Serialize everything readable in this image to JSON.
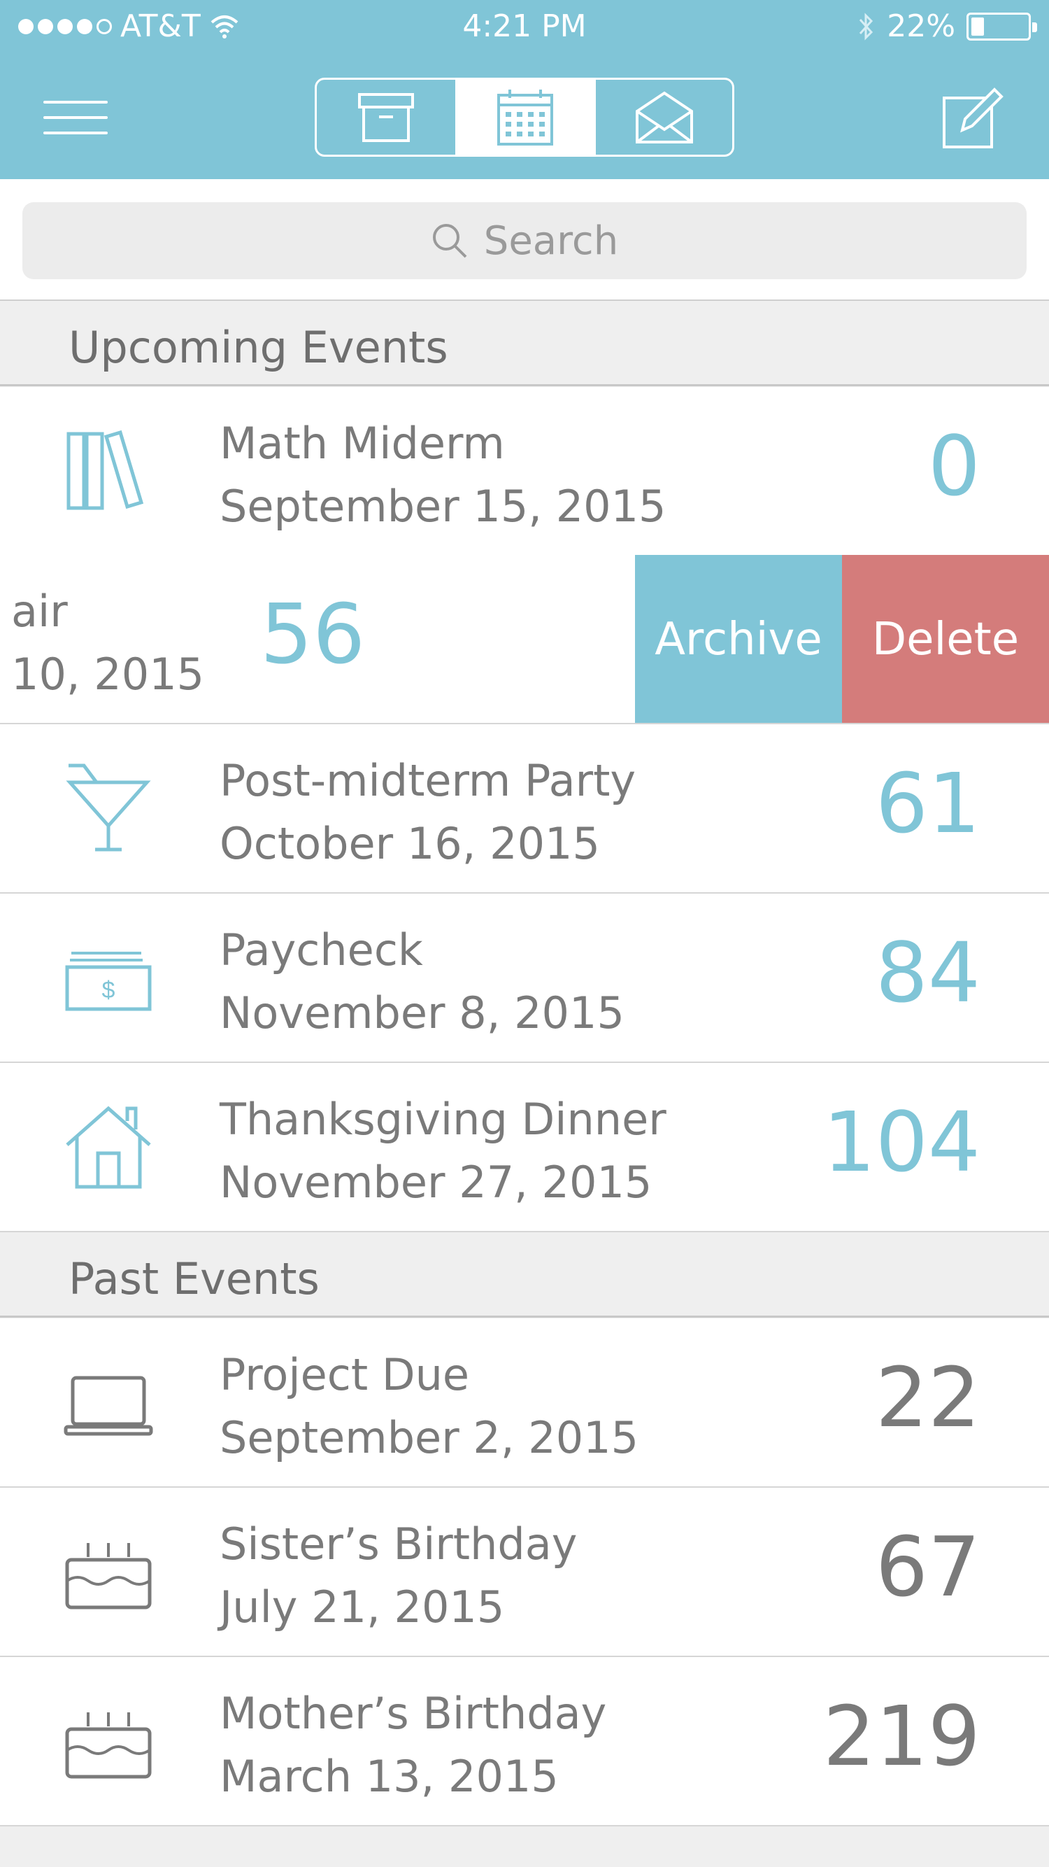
{
  "status_bar": {
    "carrier": "AT&T",
    "time": "4:21 PM",
    "battery": "22%",
    "battery_level": 0.22
  },
  "nav": {
    "segments": [
      {
        "icon": "archive-box-icon",
        "active": false
      },
      {
        "icon": "calendar-icon",
        "active": true
      },
      {
        "icon": "envelope-icon",
        "active": false
      }
    ],
    "menu_icon": "hamburger-menu-icon",
    "compose_icon": "compose-icon"
  },
  "search": {
    "placeholder": "Search",
    "icon": "search-icon"
  },
  "sections": {
    "upcoming": {
      "title": "Upcoming Events",
      "items": [
        {
          "name": "Math Miderm",
          "date": "September 15, 2015",
          "days": "0",
          "icon": "books-icon"
        },
        {
          "name": "air",
          "date": "10, 2015",
          "days": "56",
          "icon": ""
        },
        {
          "name": "Post-midterm Party",
          "date": "October 16, 2015",
          "days": "61",
          "icon": "cocktail-icon"
        },
        {
          "name": "Paycheck",
          "date": "November 8, 2015",
          "days": "84",
          "icon": "money-icon"
        },
        {
          "name": "Thanksgiving Dinner",
          "date": "November 27, 2015",
          "days": "104",
          "icon": "house-icon"
        }
      ]
    },
    "past": {
      "title": "Past Events",
      "items": [
        {
          "name": "Project Due",
          "date": "September 2, 2015",
          "days": "22",
          "icon": "laptop-icon"
        },
        {
          "name": "Sister’s Birthday",
          "date": "July 21, 2015",
          "days": "67",
          "icon": "cake-icon"
        },
        {
          "name": "Mother’s Birthday",
          "date": "March 13, 2015",
          "days": "219",
          "icon": "cake-icon"
        }
      ]
    }
  },
  "swipe_actions": {
    "archive": "Archive",
    "delete": "Delete"
  },
  "colors": {
    "accent": "#80c5d7",
    "delete": "#d47c7b",
    "text": "#7a7a7a"
  }
}
